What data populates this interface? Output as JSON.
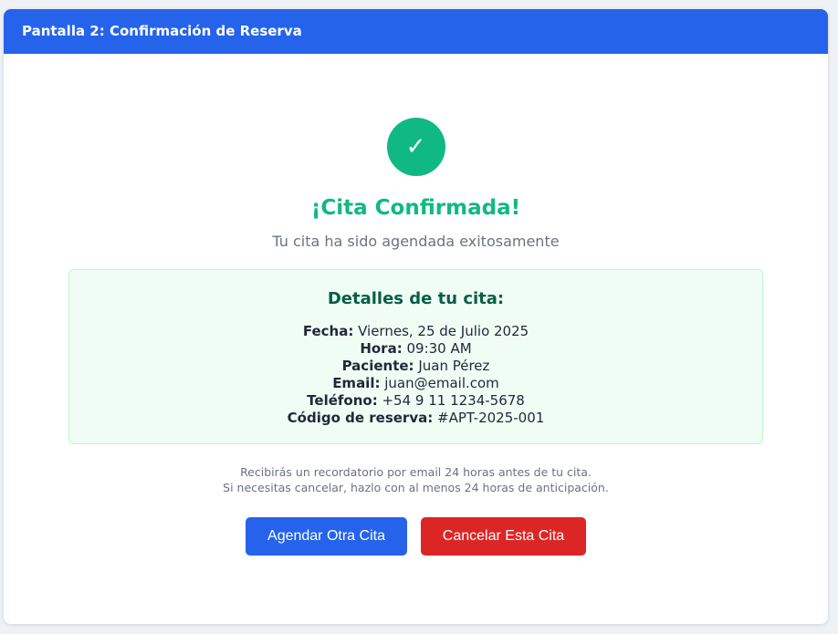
{
  "header": {
    "title": "Pantalla 2: Confirmación de Reserva"
  },
  "colors": {
    "header_bg": "#2563eb",
    "success": "#10b981",
    "details_bg": "#f0fdf4",
    "primary_button": "#2563eb",
    "danger_button": "#dc2626"
  },
  "confirmation": {
    "icon": "check-icon",
    "icon_glyph": "✓",
    "title": "¡Cita Confirmada!",
    "subtitle": "Tu cita ha sido agendada exitosamente"
  },
  "details": {
    "title": "Detalles de tu cita:",
    "rows": [
      {
        "label": "Fecha:",
        "value": "Viernes, 25 de Julio 2025"
      },
      {
        "label": "Hora:",
        "value": "09:30 AM"
      },
      {
        "label": "Paciente:",
        "value": "Juan Pérez"
      },
      {
        "label": "Email:",
        "value": "juan@email.com"
      },
      {
        "label": "Teléfono:",
        "value": "+54 9 11 1234-5678"
      },
      {
        "label": "Código de reserva:",
        "value": "#APT-2025-001"
      }
    ]
  },
  "note": {
    "line1": "Recibirás un recordatorio por email 24 horas antes de tu cita.",
    "line2": "Si necesitas cancelar, hazlo con al menos 24 horas de anticipación."
  },
  "actions": {
    "schedule_another": "Agendar Otra Cita",
    "cancel": "Cancelar Esta Cita"
  }
}
